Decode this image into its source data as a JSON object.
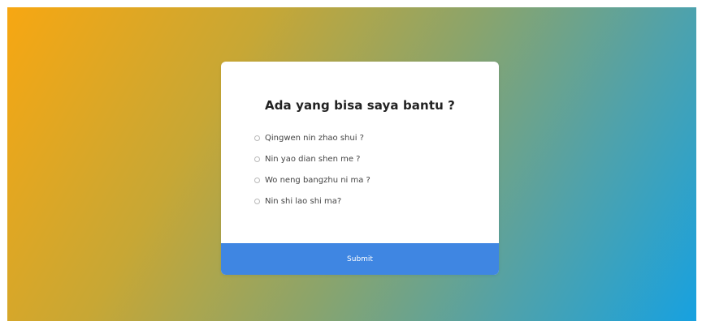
{
  "dialog": {
    "title": "Ada yang bisa saya bantu ?",
    "options": [
      {
        "label": "Qingwen nin zhao shui ?"
      },
      {
        "label": "Nin yao dian shen me ?"
      },
      {
        "label": "Wo neng bangzhu ni ma ?"
      },
      {
        "label": "Nin shi lao shi ma?"
      }
    ],
    "submit_label": "Submit"
  },
  "colors": {
    "gradient_start": "#f7a712",
    "gradient_end": "#17a1e0",
    "submit_background": "#3f86e2",
    "card_background": "#ffffff"
  }
}
